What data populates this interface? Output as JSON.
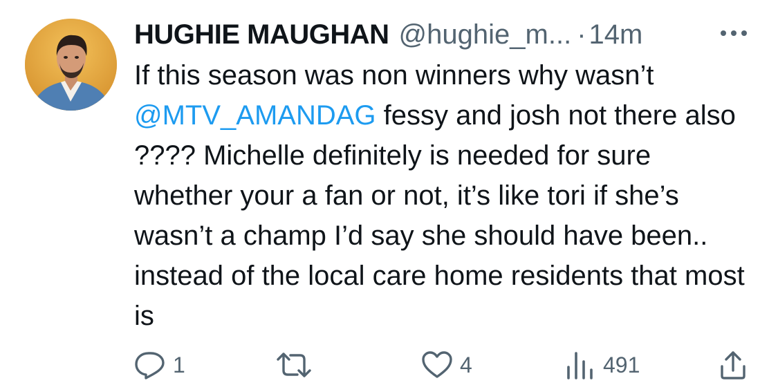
{
  "tweet": {
    "display_name": "HUGHIE MAUGHAN",
    "handle": "@hughie_m...",
    "separator": "·",
    "time": "14m",
    "text_before_mention": "If this season was non winners why wasn’t ",
    "mention": "@MTV_AMANDAG",
    "text_after_mention": " fessy and josh not there also ???? Michelle definitely is needed for sure whether your a fan or not, it’s like tori if she’s wasn’t a champ I’d say she should have been.. instead of the local care home residents that most is",
    "mention_color": "#1d9bf0"
  },
  "actions": {
    "reply_icon": "reply-icon",
    "reply_count": "1",
    "retweet_icon": "retweet-icon",
    "like_icon": "heart-icon",
    "like_count": "4",
    "views_icon": "views-icon",
    "views_count": "491",
    "share_icon": "share-icon"
  },
  "colors": {
    "text": "#0f1419",
    "secondary": "#536471",
    "link": "#1d9bf0"
  }
}
